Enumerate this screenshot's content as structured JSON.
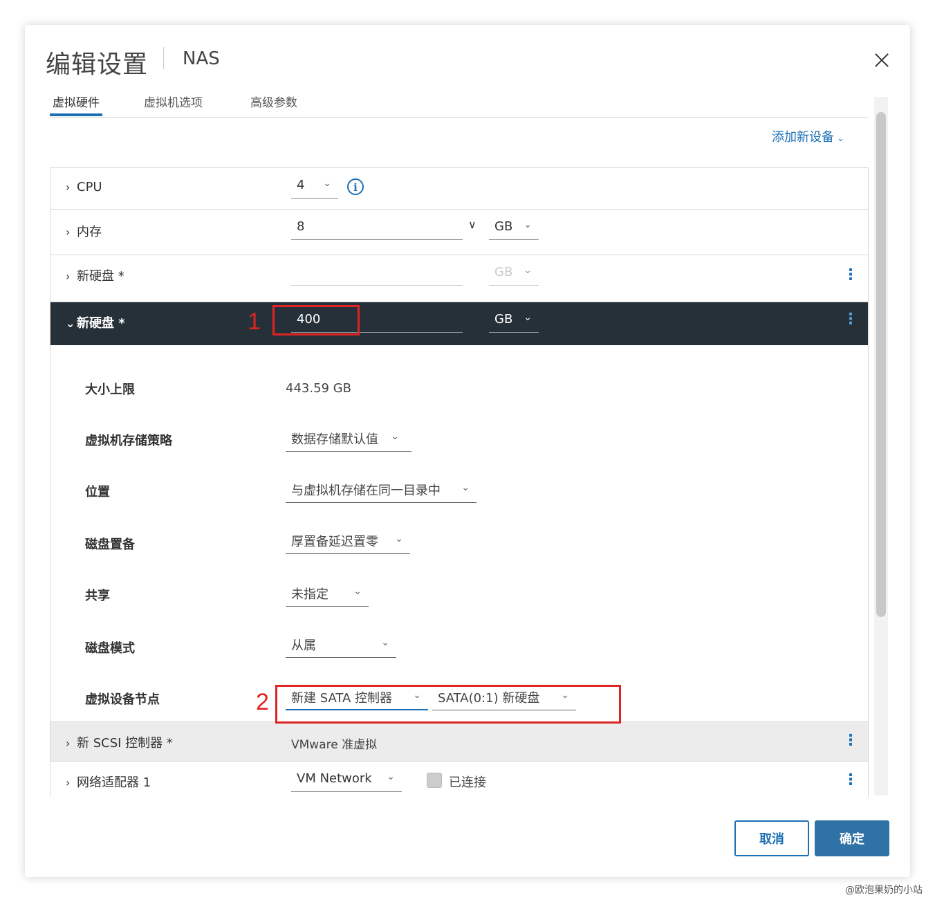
{
  "dialog": {
    "title": "编辑设置",
    "subtitle": "NAS"
  },
  "tabs": [
    {
      "label": "虚拟硬件",
      "active": true
    },
    {
      "label": "虚拟机选项",
      "active": false
    },
    {
      "label": "高级参数",
      "active": false
    }
  ],
  "add_device": {
    "label": "添加新设备"
  },
  "rows": {
    "cpu": {
      "label": "CPU",
      "value": "4"
    },
    "memory": {
      "label": "内存",
      "value": "8",
      "unit": "GB"
    },
    "disk1": {
      "label": "新硬盘 *",
      "value": "",
      "unit": "GB"
    },
    "disk2": {
      "label": "新硬盘 *",
      "value": "400",
      "unit": "GB"
    },
    "scsi": {
      "label": "新 SCSI 控制器 *",
      "value": "VMware 准虚拟"
    },
    "network": {
      "label": "网络适配器 1",
      "value": "VM Network",
      "connected_label": "已连接"
    }
  },
  "disk_detail": {
    "max_size": {
      "label": "大小上限",
      "value": "443.59 GB"
    },
    "storage_policy": {
      "label": "虚拟机存储策略",
      "value": "数据存储默认值"
    },
    "location": {
      "label": "位置",
      "value": "与虚拟机存储在同一目录中"
    },
    "provisioning": {
      "label": "磁盘置备",
      "value": "厚置备延迟置零"
    },
    "sharing": {
      "label": "共享",
      "value": "未指定"
    },
    "disk_mode": {
      "label": "磁盘模式",
      "value": "从属"
    },
    "device_node": {
      "label": "虚拟设备节点",
      "controller": "新建 SATA 控制器",
      "node": "SATA(0:1) 新硬盘"
    }
  },
  "annotations": {
    "one": "1",
    "two": "2"
  },
  "buttons": {
    "cancel": "取消",
    "ok": "确定"
  },
  "watermark": "@欧泡果奶的小站",
  "colors": {
    "accent": "#1b6fb5",
    "selected_row": "#263038",
    "annotation": "#e02424"
  }
}
